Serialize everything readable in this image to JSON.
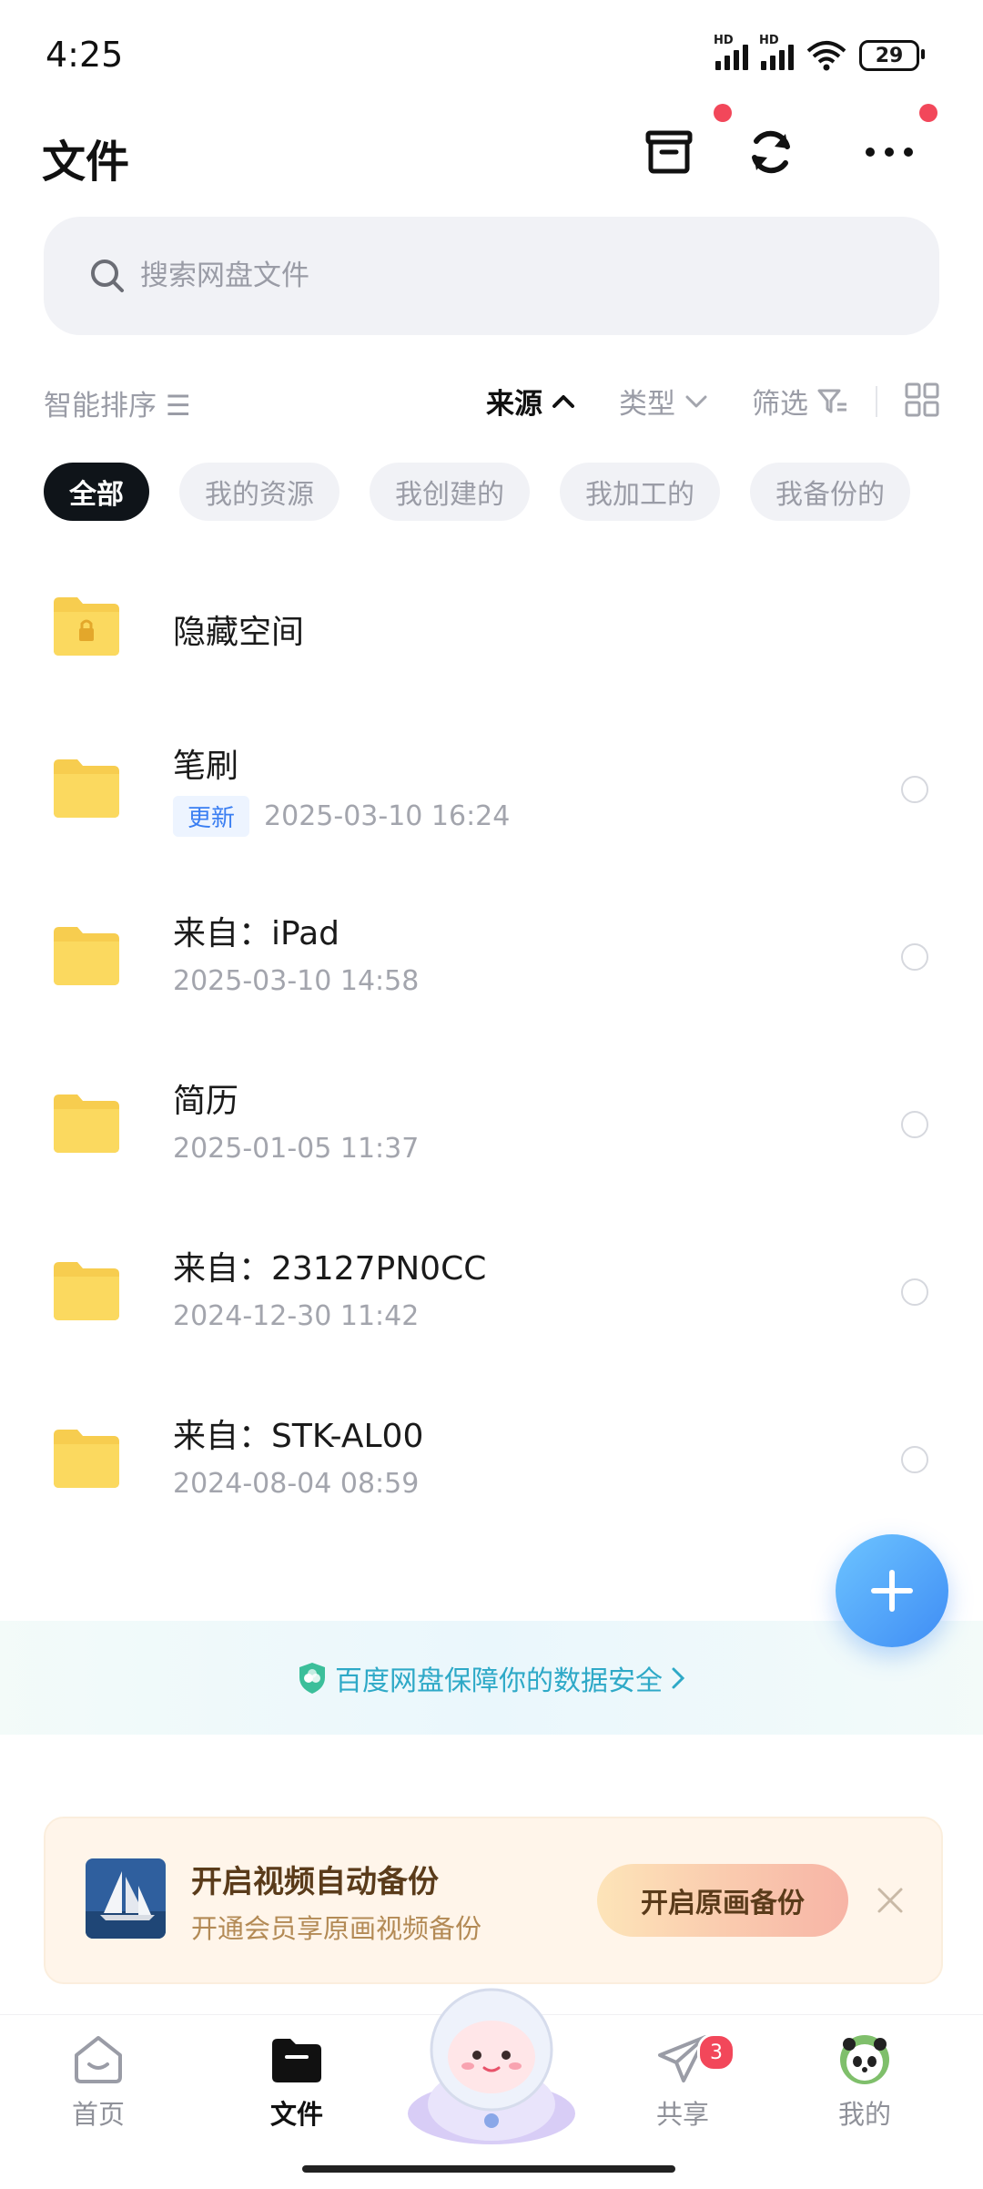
{
  "status_bar": {
    "time": "4:25",
    "hd1": "HD",
    "hd2": "HD",
    "battery": "29"
  },
  "header": {
    "title": "文件"
  },
  "search": {
    "placeholder": "搜索网盘文件"
  },
  "sort": {
    "label": "智能排序 ☰"
  },
  "filters": {
    "source": "来源",
    "type": "类型",
    "filter": "筛选"
  },
  "chips": [
    "全部",
    "我的资源",
    "我创建的",
    "我加工的",
    "我备份的"
  ],
  "files": [
    {
      "name": "隐藏空间",
      "date": "",
      "badge": ""
    },
    {
      "name": "笔刷",
      "date": "2025-03-10  16:24",
      "badge": "更新"
    },
    {
      "name": "来自：iPad",
      "date": "2025-03-10  14:58",
      "badge": ""
    },
    {
      "name": "简历",
      "date": "2025-01-05  11:37",
      "badge": ""
    },
    {
      "name": "来自：23127PN0CC",
      "date": "2024-12-30  11:42",
      "badge": ""
    },
    {
      "name": "来自：STK-AL00",
      "date": "2024-08-04  08:59",
      "badge": ""
    }
  ],
  "safety_banner": {
    "text": "百度网盘保障你的数据安全"
  },
  "promo": {
    "title": "开启视频自动备份",
    "subtitle": "开通会员享原画视频备份",
    "button": "开启原画备份"
  },
  "tabbar": {
    "home": "首页",
    "files": "文件",
    "share": "共享",
    "share_badge": "3",
    "me": "我的"
  },
  "colors": {
    "accent": "#3a7ef2",
    "badge_red": "#f2475a",
    "folder": "#f7cd4f",
    "safety_text": "#2ea9c7"
  }
}
